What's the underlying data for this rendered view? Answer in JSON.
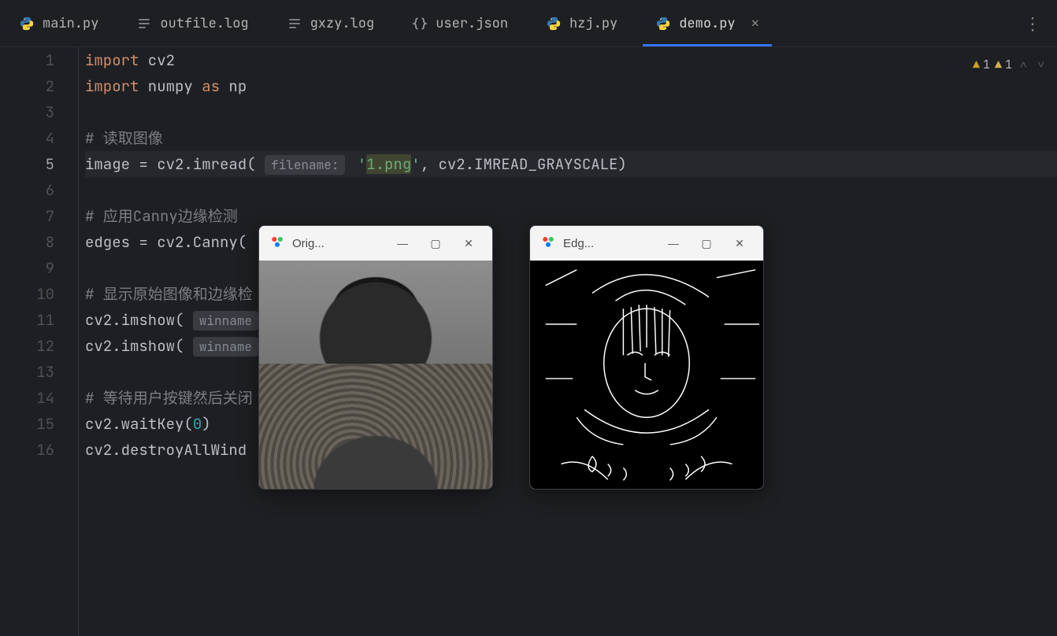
{
  "tabs": [
    {
      "label": "main.py",
      "icon": "python"
    },
    {
      "label": "outfile.log",
      "icon": "text"
    },
    {
      "label": "gxzy.log",
      "icon": "text"
    },
    {
      "label": "user.json",
      "icon": "json"
    },
    {
      "label": "hzj.py",
      "icon": "python"
    },
    {
      "label": "demo.py",
      "icon": "python",
      "active": true,
      "closeable": true
    }
  ],
  "warnings": {
    "warn1": "1",
    "warn2": "1"
  },
  "gutter": [
    "1",
    "2",
    "3",
    "4",
    "5",
    "6",
    "7",
    "8",
    "9",
    "10",
    "11",
    "12",
    "13",
    "14",
    "15",
    "16"
  ],
  "code": {
    "l1_kw1": "import",
    "l1_id": " cv2",
    "l2_kw1": "import",
    "l2_id": " numpy ",
    "l2_kw2": "as",
    "l2_id2": " np",
    "l4_cmt": "# 读取图像",
    "l5_a": "image = cv2.imread(",
    "l5_hint": "filename:",
    "l5_str_pre": " '",
    "l5_str_hl": "1.png",
    "l5_str_post": "'",
    "l5_b": ", cv2.IMREAD_GRAYSCALE)",
    "l7_cmt": "# 应用Canny边缘检测",
    "l8_a": "edges = cv2.Canny(",
    "l10_cmt": "# 显示原始图像和边缘检",
    "l11_a": "cv2.imshow(",
    "l11_hint": "winname",
    "l12_a": "cv2.imshow(",
    "l12_hint": "winname",
    "l14_cmt": "# 等待用户按键然后关闭",
    "l15_a": "cv2.waitKey(",
    "l15_num": "0",
    "l15_b": ")",
    "l16_a": "cv2.destroyAllWind"
  },
  "windows": {
    "orig": {
      "title": "Orig...",
      "minimize": "—",
      "maximize": "▢",
      "close": "✕"
    },
    "edge": {
      "title": "Edg...",
      "minimize": "—",
      "maximize": "▢",
      "close": "✕"
    }
  }
}
